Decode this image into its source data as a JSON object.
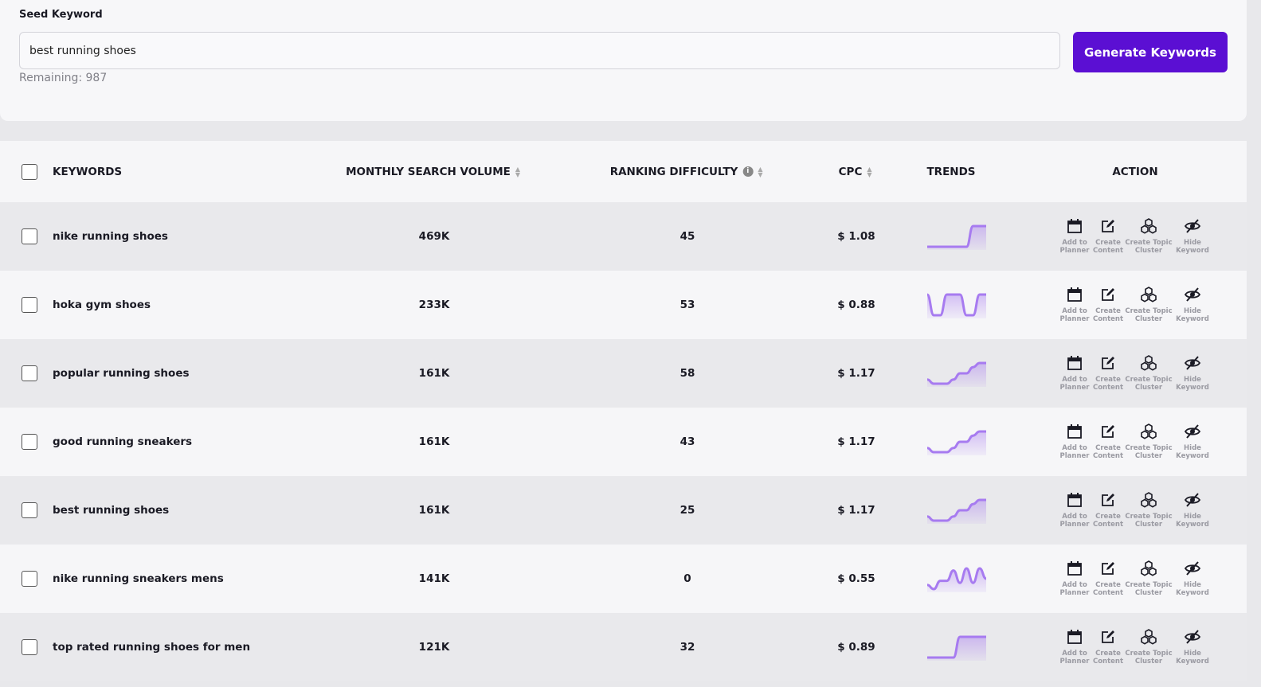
{
  "seed": {
    "label": "Seed Keyword",
    "value": "best running shoes",
    "remaining": "Remaining: 987",
    "button": "Generate Keywords"
  },
  "colors": {
    "accent": "#5b0fd3",
    "trend": "#a77bf0"
  },
  "table": {
    "headers": {
      "keywords": "KEYWORDS",
      "volume": "MONTHLY SEARCH VOLUME",
      "difficulty": "RANKING DIFFICULTY",
      "cpc": "CPC",
      "trends": "TRENDS",
      "action": "ACTION"
    },
    "actions": [
      {
        "label1": "Add to",
        "label2": "Planner",
        "icon": "calendar-icon"
      },
      {
        "label1": "Create",
        "label2": "Content",
        "icon": "edit-icon"
      },
      {
        "label1": "Create Topic",
        "label2": "Cluster",
        "icon": "hexagons-icon"
      },
      {
        "label1": "Hide",
        "label2": "Keyword",
        "icon": "eye-slash-icon"
      }
    ],
    "rows": [
      {
        "keyword": "nike running shoes",
        "volume": "469K",
        "difficulty": "45",
        "cpc": "$ 1.08",
        "trend": [
          0,
          0,
          0,
          0,
          0,
          0,
          0,
          1,
          1,
          1
        ]
      },
      {
        "keyword": "hoka gym shoes",
        "volume": "233K",
        "difficulty": "53",
        "cpc": "$ 0.88",
        "trend": [
          1,
          0,
          0,
          1,
          1,
          1,
          0,
          0,
          1,
          1
        ]
      },
      {
        "keyword": "popular running shoes",
        "volume": "161K",
        "difficulty": "58",
        "cpc": "$ 1.17",
        "trend": [
          0.2,
          0,
          0,
          0,
          0.2,
          0.5,
          0.5,
          0.8,
          1,
          1
        ]
      },
      {
        "keyword": "good running sneakers",
        "volume": "161K",
        "difficulty": "43",
        "cpc": "$ 1.17",
        "trend": [
          0.2,
          0,
          0,
          0,
          0.2,
          0.5,
          0.5,
          0.8,
          1,
          1
        ]
      },
      {
        "keyword": "best running shoes",
        "volume": "161K",
        "difficulty": "25",
        "cpc": "$ 1.17",
        "trend": [
          0.2,
          0,
          0,
          0,
          0.2,
          0.5,
          0.5,
          0.8,
          1,
          1
        ]
      },
      {
        "keyword": "nike running sneakers mens",
        "volume": "141K",
        "difficulty": "0",
        "cpc": "$ 0.55",
        "trend": [
          0.2,
          0,
          0.4,
          0.4,
          0.9,
          0.3,
          1,
          0.3,
          1,
          0.5
        ]
      },
      {
        "keyword": "top rated running shoes for men",
        "volume": "121K",
        "difficulty": "32",
        "cpc": "$ 0.89",
        "trend": [
          0,
          0,
          0,
          0,
          0,
          1,
          1,
          1,
          1,
          1
        ]
      }
    ]
  }
}
